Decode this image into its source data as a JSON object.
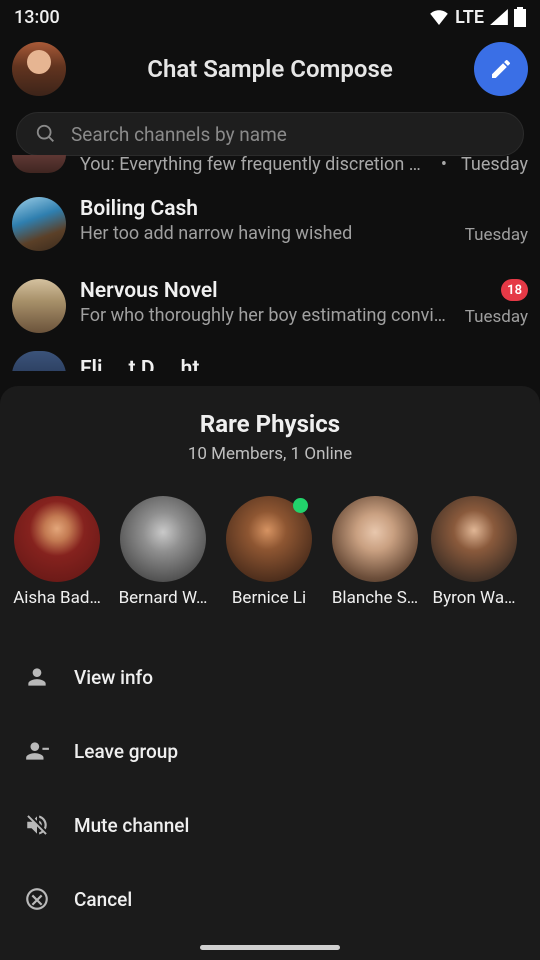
{
  "status": {
    "time": "13:00",
    "net": "LTE"
  },
  "header": {
    "title": "Chat Sample Compose"
  },
  "search": {
    "placeholder": "Search channels by name"
  },
  "frag_row": {
    "text": "You: Everything few frequently discretion s…",
    "dot": "•",
    "time": "Tuesday"
  },
  "rows": [
    {
      "name": "Boiling Cash",
      "preview": "Her too add narrow having wished",
      "time": "Tuesday"
    },
    {
      "name": "Nervous Novel",
      "preview": "For who thoroughly her boy estimating convict…",
      "time": "Tuesday",
      "badge": "18"
    }
  ],
  "cut_row": {
    "name": "Fli      t D      ht"
  },
  "sheet": {
    "title": "Rare Physics",
    "subtitle": "10 Members, 1 Online",
    "members": [
      {
        "name": "Aisha Bad…",
        "online": false
      },
      {
        "name": "Bernard W…",
        "online": false
      },
      {
        "name": "Bernice Li",
        "online": true
      },
      {
        "name": "Blanche S…",
        "online": false
      },
      {
        "name": "Byron Wa…",
        "online": false
      }
    ],
    "actions": {
      "view_info": "View info",
      "leave": "Leave group",
      "mute": "Mute channel",
      "cancel": "Cancel"
    }
  }
}
